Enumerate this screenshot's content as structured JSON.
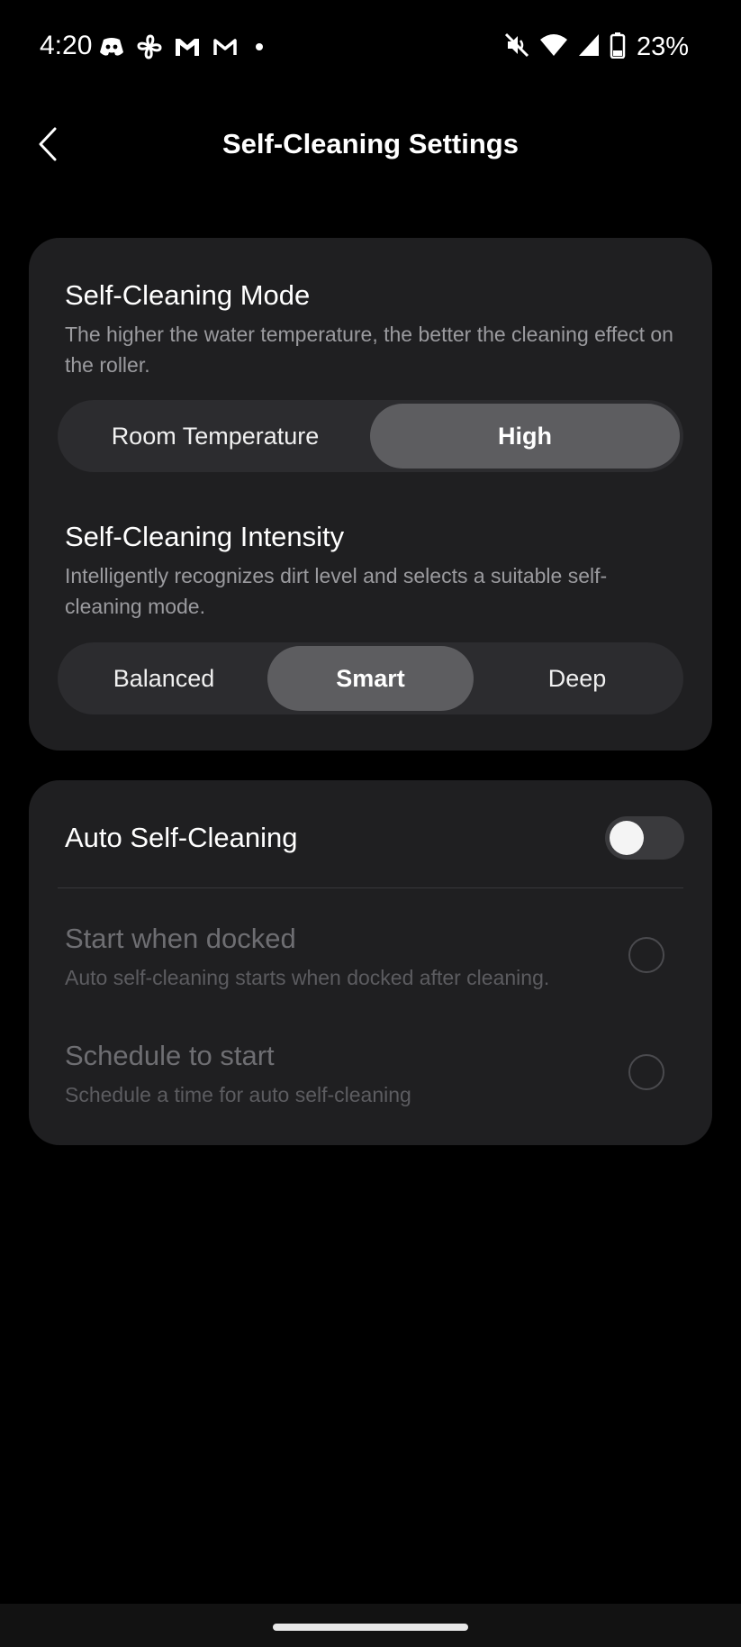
{
  "status_bar": {
    "time": "4:20",
    "battery_percent": "23%",
    "left_icons": [
      "discord-icon",
      "fan-icon",
      "gmail-icon",
      "gmail-outline-icon",
      "notification-dot-icon"
    ],
    "right_icons": [
      "mute-icon",
      "wifi-icon",
      "signal-icon",
      "battery-icon"
    ]
  },
  "header": {
    "title": "Self-Cleaning Settings",
    "back_icon": "chevron-left-icon"
  },
  "mode_section": {
    "title": "Self-Cleaning Mode",
    "description": "The higher the water temperature, the better the cleaning effect on the roller.",
    "options": [
      {
        "label": "Room Temperature",
        "selected": false
      },
      {
        "label": "High",
        "selected": true
      }
    ]
  },
  "intensity_section": {
    "title": "Self-Cleaning Intensity",
    "description": "Intelligently recognizes dirt level and selects a suitable self-cleaning mode.",
    "options": [
      {
        "label": "Balanced",
        "selected": false
      },
      {
        "label": "Smart",
        "selected": true
      },
      {
        "label": "Deep",
        "selected": false
      }
    ]
  },
  "auto_section": {
    "label": "Auto Self-Cleaning",
    "enabled": false,
    "options": [
      {
        "title": "Start when docked",
        "description": "Auto self-cleaning starts when docked after cleaning.",
        "selected": false
      },
      {
        "title": "Schedule to start",
        "description": "Schedule a time for auto self-cleaning",
        "selected": false
      }
    ]
  },
  "colors": {
    "background": "#000000",
    "card": "#1f1f21",
    "segment_track": "#2c2c2f",
    "segment_selected": "#5d5d60",
    "muted_text": "#9b9b9f",
    "disabled_text": "#6e6e72"
  }
}
